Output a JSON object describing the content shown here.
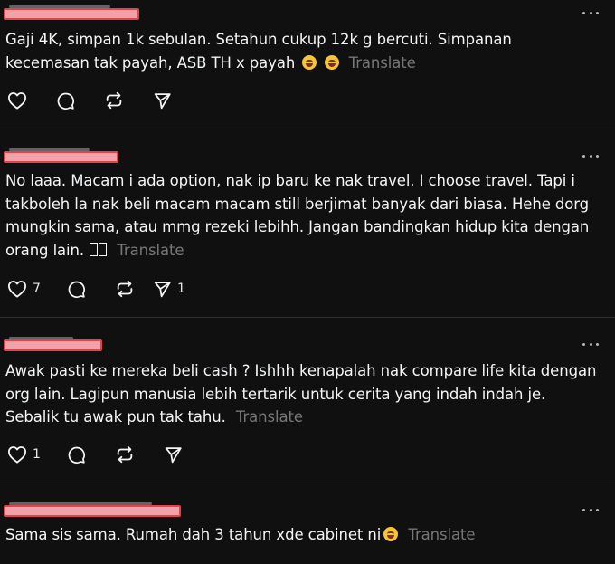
{
  "translate_label": "Translate",
  "posts": [
    {
      "text": "Gaji 4K, simpan 1k sebulan. Setahun cukup 12k g bercuti. Simpanan kecemasan tak payah, ASB TH x payah",
      "emoji": [
        "grinning-tears-emoji",
        "grinning-tears-emoji"
      ],
      "likes": "",
      "shares": ""
    },
    {
      "text": "No laaa. Macam i ada option, nak ip baru ke nak travel. I choose travel. Tapi i takboleh la nak beli macam macam still berjimat banyak dari biasa. Hehe dorg mungkin sama, atau mmg rezeki lebihh. Jangan bandingkan hidup kita dengan orang lain.",
      "likes": "7",
      "shares": "1"
    },
    {
      "text": "Awak pasti ke mereka beli cash ? Ishhh kenapalah nak compare life kita dengan org lain. Lagipun manusia lebih tertarik untuk cerita yang indah indah je. Sebalik tu awak pun tak tahu.",
      "likes": "1",
      "shares": ""
    },
    {
      "text": "Sama sis sama. Rumah dah 3 tahun xde cabinet ni",
      "emoji": [
        "sweat-smile-emoji"
      ]
    }
  ],
  "colors": {
    "background": "#101010",
    "text": "#f3f5f7",
    "muted": "#777777",
    "divider": "#2e2e2e",
    "redaction_fill": "#f1a1a8",
    "redaction_border": "#e0424e"
  }
}
